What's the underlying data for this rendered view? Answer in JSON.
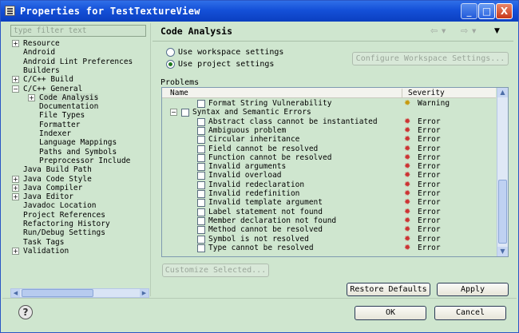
{
  "window": {
    "title": "Properties for TestTextureView",
    "controls": {
      "minimize": "_",
      "maximize": "□",
      "close": "X"
    }
  },
  "filter": {
    "placeholder": "type filter text"
  },
  "tree": [
    {
      "label": "Resource",
      "expander": "+",
      "level": 0
    },
    {
      "label": "Android",
      "expander": "",
      "level": 0
    },
    {
      "label": "Android Lint Preferences",
      "expander": "",
      "level": 0
    },
    {
      "label": "Builders",
      "expander": "",
      "level": 0
    },
    {
      "label": "C/C++ Build",
      "expander": "+",
      "level": 0
    },
    {
      "label": "C/C++ General",
      "expander": "−",
      "level": 0
    },
    {
      "label": "Code Analysis",
      "expander": "+",
      "level": 1,
      "selected": true
    },
    {
      "label": "Documentation",
      "expander": "",
      "level": 1
    },
    {
      "label": "File Types",
      "expander": "",
      "level": 1
    },
    {
      "label": "Formatter",
      "expander": "",
      "level": 1
    },
    {
      "label": "Indexer",
      "expander": "",
      "level": 1
    },
    {
      "label": "Language Mappings",
      "expander": "",
      "level": 1
    },
    {
      "label": "Paths and Symbols",
      "expander": "",
      "level": 1
    },
    {
      "label": "Preprocessor Include",
      "expander": "",
      "level": 1
    },
    {
      "label": "Java Build Path",
      "expander": "",
      "level": 0
    },
    {
      "label": "Java Code Style",
      "expander": "+",
      "level": 0
    },
    {
      "label": "Java Compiler",
      "expander": "+",
      "level": 0
    },
    {
      "label": "Java Editor",
      "expander": "+",
      "level": 0
    },
    {
      "label": "Javadoc Location",
      "expander": "",
      "level": 0
    },
    {
      "label": "Project References",
      "expander": "",
      "level": 0
    },
    {
      "label": "Refactoring History",
      "expander": "",
      "level": 0
    },
    {
      "label": "Run/Debug Settings",
      "expander": "",
      "level": 0
    },
    {
      "label": "Task Tags",
      "expander": "",
      "level": 0
    },
    {
      "label": "Validation",
      "expander": "+",
      "level": 0
    }
  ],
  "header": {
    "title": "Code Analysis",
    "back_icon": "⇦",
    "forward_icon": "⇨",
    "menu_icon": "▼"
  },
  "settings": {
    "workspace_label": "Use workspace settings",
    "project_label": "Use project settings",
    "selected": "project",
    "configure_button": "Configure Workspace Settings..."
  },
  "problems": {
    "label": "Problems",
    "columns": {
      "name": "Name",
      "severity": "Severity"
    },
    "top_row": {
      "name": "Format String Vulnerability",
      "severity": "Warning",
      "icon": "warning-icon"
    },
    "group": {
      "name": "Syntax and Semantic Errors",
      "expander": "−"
    },
    "rows": [
      {
        "name": "Abstract class cannot be instantiated",
        "severity": "Error"
      },
      {
        "name": "Ambiguous problem",
        "severity": "Error"
      },
      {
        "name": "Circular inheritance",
        "severity": "Error"
      },
      {
        "name": "Field cannot be resolved",
        "severity": "Error"
      },
      {
        "name": "Function cannot be resolved",
        "severity": "Error"
      },
      {
        "name": "Invalid arguments",
        "severity": "Error"
      },
      {
        "name": "Invalid overload",
        "severity": "Error"
      },
      {
        "name": "Invalid redeclaration",
        "severity": "Error"
      },
      {
        "name": "Invalid redefinition",
        "severity": "Error"
      },
      {
        "name": "Invalid template argument",
        "severity": "Error"
      },
      {
        "name": "Label statement not found",
        "severity": "Error"
      },
      {
        "name": "Member declaration not found",
        "severity": "Error"
      },
      {
        "name": "Method cannot be resolved",
        "severity": "Error"
      },
      {
        "name": "Symbol is not resolved",
        "severity": "Error"
      },
      {
        "name": "Type cannot be resolved",
        "severity": "Error"
      }
    ]
  },
  "buttons": {
    "customize": "Customize Selected...",
    "restore": "Restore Defaults",
    "apply": "Apply",
    "ok": "OK",
    "cancel": "Cancel",
    "help": "?"
  },
  "scroll": {
    "up": "▲",
    "down": "▼",
    "left": "◀",
    "right": "▶"
  }
}
